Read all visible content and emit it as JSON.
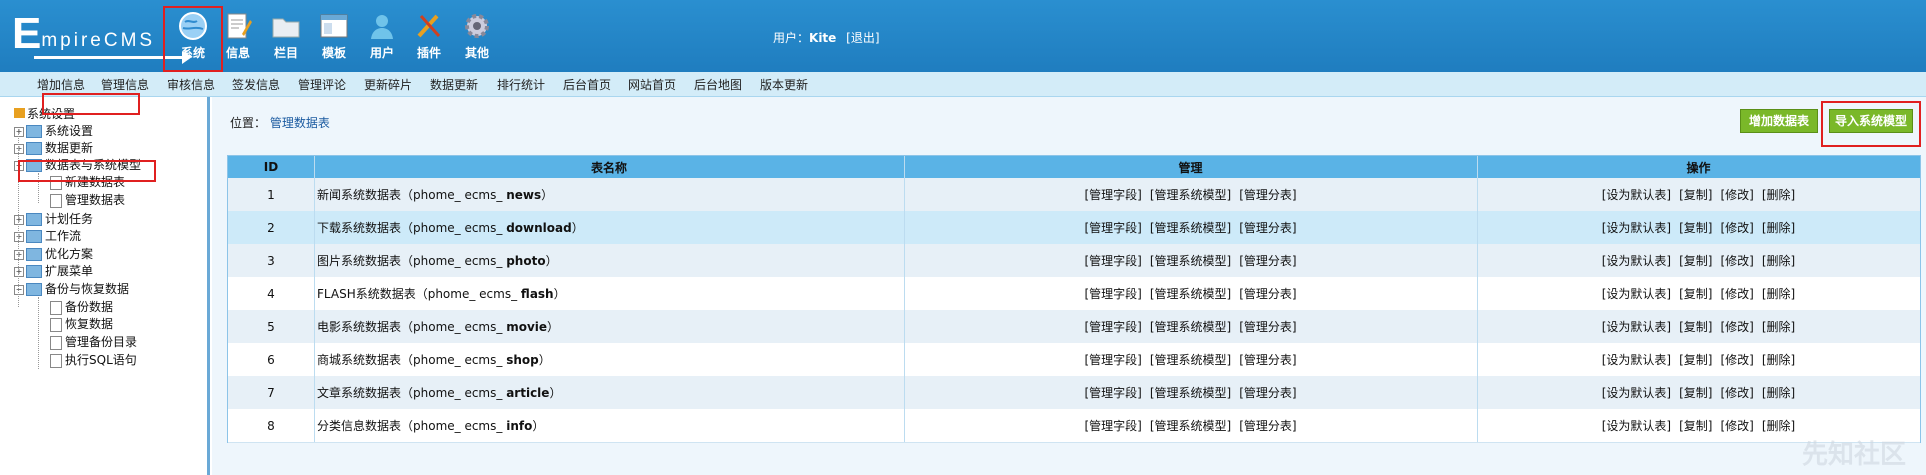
{
  "header": {
    "logo_big": "E",
    "logo_small": "mpireCMS",
    "nav": [
      {
        "label": "系统",
        "icon": "globe-icon",
        "active": true
      },
      {
        "label": "信息",
        "icon": "edit-document-icon",
        "active": false
      },
      {
        "label": "栏目",
        "icon": "folder-icon",
        "active": false
      },
      {
        "label": "模板",
        "icon": "window-template-icon",
        "active": false
      },
      {
        "label": "用户",
        "icon": "user-icon",
        "active": false
      },
      {
        "label": "插件",
        "icon": "tools-icon",
        "active": false
      },
      {
        "label": "其他",
        "icon": "gear-icon",
        "active": false
      }
    ],
    "user_label": "用户：",
    "user_name": "Kite",
    "logout": "[退出]"
  },
  "submenu": [
    "增加信息",
    "管理信息",
    "审核信息",
    "签发信息",
    "管理评论",
    "更新碎片",
    "数据更新",
    "排行统计",
    "后台首页",
    "网站首页",
    "后台地图",
    "版本更新"
  ],
  "sidebar": {
    "root": "系统设置",
    "items": [
      {
        "label": "系统设置",
        "type": "folder",
        "expanded": false
      },
      {
        "label": "数据更新",
        "type": "folder",
        "expanded": false
      },
      {
        "label": "数据表与系统模型",
        "type": "folder",
        "expanded": true,
        "highlighted": true
      },
      {
        "label": "新建数据表",
        "type": "doc"
      },
      {
        "label": "管理数据表",
        "type": "doc",
        "highlighted": true
      },
      {
        "label": "计划任务",
        "type": "folder",
        "expanded": false
      },
      {
        "label": "工作流",
        "type": "folder",
        "expanded": false
      },
      {
        "label": "优化方案",
        "type": "folder",
        "expanded": false
      },
      {
        "label": "扩展菜单",
        "type": "folder",
        "expanded": false
      },
      {
        "label": "备份与恢复数据",
        "type": "folder",
        "expanded": true
      },
      {
        "label": "备份数据",
        "type": "doc"
      },
      {
        "label": "恢复数据",
        "type": "doc"
      },
      {
        "label": "管理备份目录",
        "type": "doc"
      },
      {
        "label": "执行SQL语句",
        "type": "doc"
      }
    ]
  },
  "main": {
    "crumb_label": "位置：",
    "crumb_link": "管理数据表",
    "add_table_button": "增加数据表",
    "import_model_button": "导入系统模型",
    "table": {
      "headers": [
        "ID",
        "表名称",
        "管理",
        "操作"
      ],
      "manage_links": [
        "[管理字段]",
        "[管理系统模型]",
        "[管理分表]"
      ],
      "op_links": [
        "[设为默认表]",
        "[复制]",
        "[修改]",
        "[删除]"
      ],
      "rows": [
        {
          "id": "1",
          "name": "新闻系统数据表（phome_ ecms_",
          "table": "news"
        },
        {
          "id": "2",
          "name": "下载系统数据表（phome_ ecms_",
          "table": "download"
        },
        {
          "id": "3",
          "name": "图片系统数据表（phome_ ecms_",
          "table": "photo"
        },
        {
          "id": "4",
          "name": "FLASH系统数据表（phome_ ecms_",
          "table": "flash"
        },
        {
          "id": "5",
          "name": "电影系统数据表（phome_ ecms_",
          "table": "movie"
        },
        {
          "id": "6",
          "name": "商城系统数据表（phome_ ecms_",
          "table": "shop"
        },
        {
          "id": "7",
          "name": "文章系统数据表（phome_ ecms_",
          "table": "article"
        },
        {
          "id": "8",
          "name": "分类信息数据表（phome_ ecms_",
          "table": "info"
        }
      ],
      "close_paren": "）"
    }
  },
  "watermark": "先知社区",
  "colors": {
    "header_bg": "#2a8fd0",
    "table_header": "#5ab3e6",
    "button_green": "#7ab829",
    "highlight_red": "#e02020",
    "selected_row": "#cdeaf9"
  }
}
